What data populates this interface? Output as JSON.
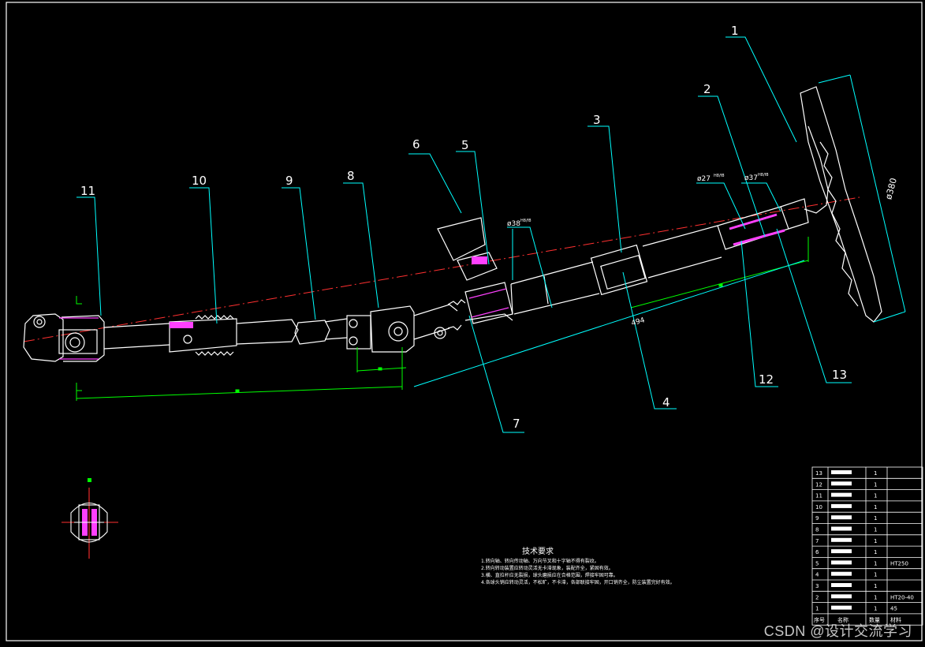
{
  "colors": {
    "background": "#000000",
    "outline": "#ffffff",
    "leader": "#00ffff",
    "dimension": "#00ff00",
    "centerline": "#ff3030",
    "hatch": "#ff40ff",
    "text": "#ffffff"
  },
  "callouts": [
    "1",
    "2",
    "3",
    "4",
    "5",
    "6",
    "7",
    "8",
    "9",
    "10",
    "11",
    "12",
    "13"
  ],
  "dimensions": {
    "d380": "ø380",
    "d27": "ø27",
    "d27_fit": "H8/f8",
    "d37": "ø37",
    "d37_fit": "H8/f8",
    "d38": "ø38",
    "d38_fit": "H8/f8",
    "len494": "494"
  },
  "tech": {
    "title": "技术要求",
    "lines": [
      "1.转向轴、转向传动轴、万向节叉和十字轴不得有裂纹。",
      "2.转向转动装置应转动灵活无卡滞现象，装配齐全，紧固有效。",
      "3.横、直拉杆应无裂损，球头磨损应在合格范围，焊接牢固可靠。",
      "4.各球头销应转动灵活，不松旷，不卡滞，各部联接牢固，开口销齐全，防尘装置完好有效。"
    ]
  },
  "bom": {
    "header": {
      "no": "序号",
      "name": "名称",
      "qty": "数量",
      "mat": "材料"
    },
    "rows": [
      {
        "no": "13",
        "name": "",
        "qty": "1",
        "mat": ""
      },
      {
        "no": "12",
        "name": "",
        "qty": "1",
        "mat": ""
      },
      {
        "no": "11",
        "name": "",
        "qty": "1",
        "mat": ""
      },
      {
        "no": "10",
        "name": "",
        "qty": "1",
        "mat": ""
      },
      {
        "no": "9",
        "name": "",
        "qty": "1",
        "mat": ""
      },
      {
        "no": "8",
        "name": "",
        "qty": "1",
        "mat": ""
      },
      {
        "no": "7",
        "name": "",
        "qty": "1",
        "mat": ""
      },
      {
        "no": "6",
        "name": "",
        "qty": "1",
        "mat": ""
      },
      {
        "no": "5",
        "name": "",
        "qty": "1",
        "mat": "HT250"
      },
      {
        "no": "4",
        "name": "",
        "qty": "1",
        "mat": ""
      },
      {
        "no": "3",
        "name": "",
        "qty": "1",
        "mat": ""
      },
      {
        "no": "2",
        "name": "",
        "qty": "1",
        "mat": "HT20-40"
      },
      {
        "no": "1",
        "name": "",
        "qty": "1",
        "mat": "45"
      }
    ]
  },
  "watermark": "CSDN @设计交流学习"
}
